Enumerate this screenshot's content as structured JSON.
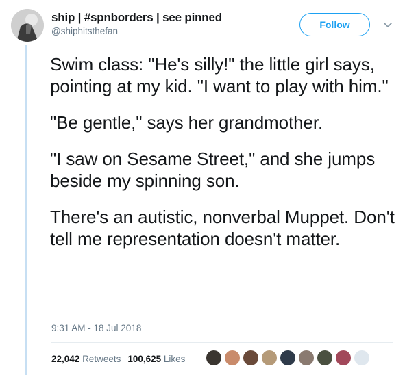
{
  "user": {
    "display_name": "ship | #spnborders | see pinned",
    "handle": "@shiphitsthefan"
  },
  "follow_button": {
    "label": "Follow"
  },
  "tweet": {
    "paragraphs": [
      "Swim class: \"He's silly!\" the little girl says, pointing at my kid. \"I want to play with him.\"",
      "\"Be gentle,\" says her grandmother.",
      "\"I saw on Sesame Street,\" and she jumps beside my spinning son.",
      "There's an autistic, nonverbal Muppet. Don't tell me representation doesn't matter."
    ],
    "timestamp": "9:31 AM - 18 Jul 2018"
  },
  "stats": {
    "retweets_count": "22,042",
    "retweets_label": "Retweets",
    "likes_count": "100,625",
    "likes_label": "Likes"
  },
  "likers": [
    {
      "color": "#3a3530"
    },
    {
      "color": "#c98b6b"
    },
    {
      "color": "#6a4a3a"
    },
    {
      "color": "#b59a78"
    },
    {
      "color": "#2f3b4a"
    },
    {
      "color": "#8a7a70"
    },
    {
      "color": "#4a5040"
    },
    {
      "color": "#a2485a"
    },
    {
      "color": "#dfe7ee"
    }
  ],
  "colors": {
    "accent": "#1da1f2",
    "text": "#14171a",
    "muted": "#657786",
    "thread_line": "#c7dff3"
  }
}
